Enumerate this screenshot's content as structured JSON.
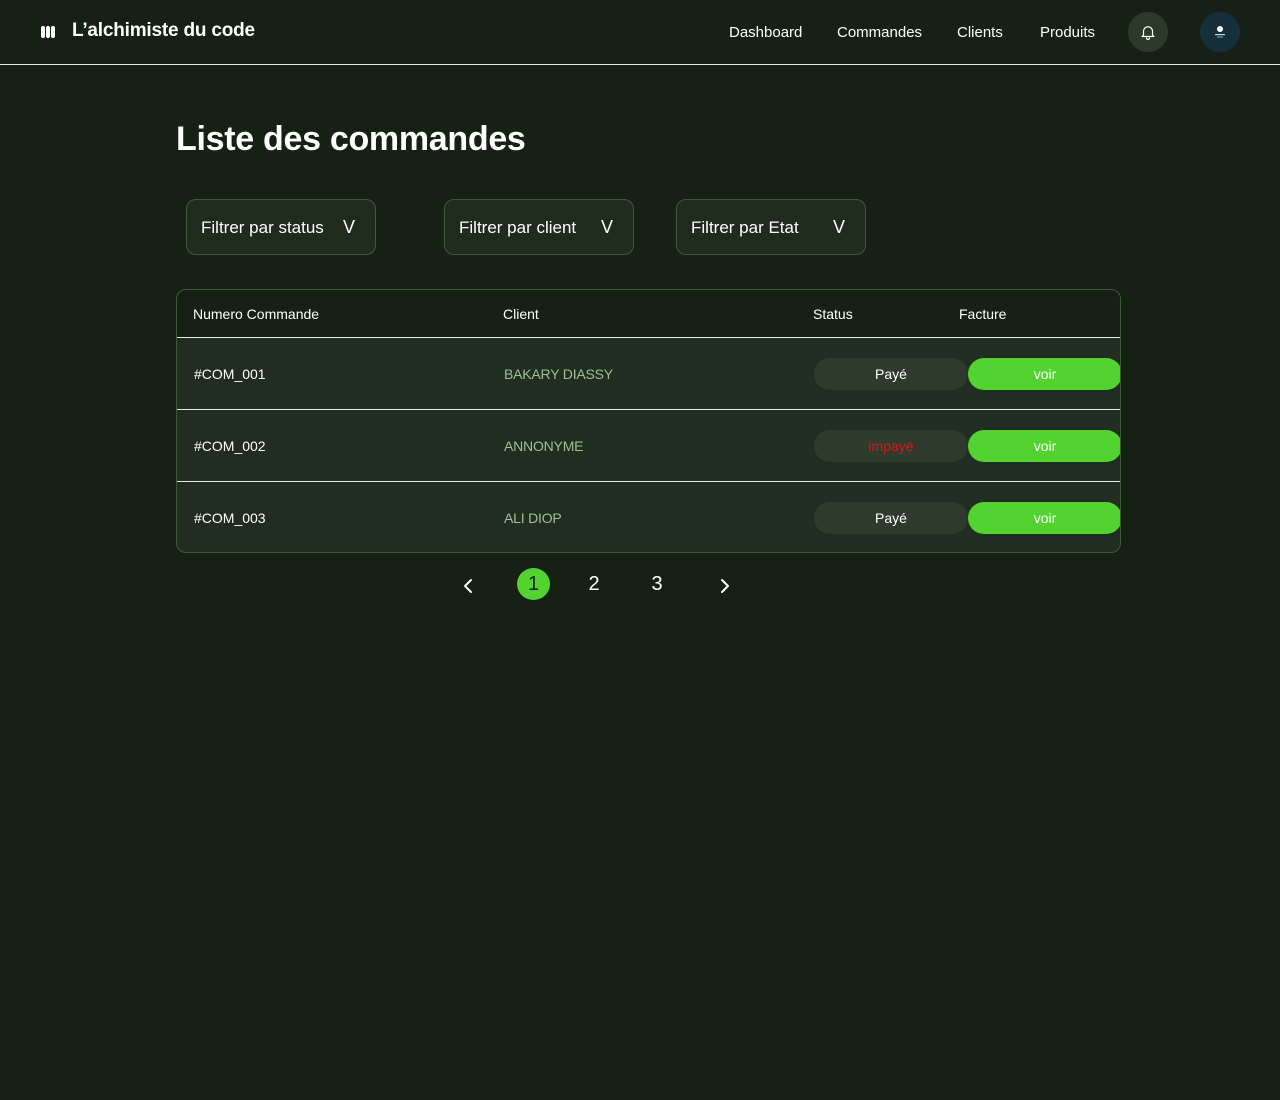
{
  "header": {
    "brand": "L’alchimiste du code",
    "nav": [
      "Dashboard",
      "Commandes",
      "Clients",
      "Produits"
    ]
  },
  "page_title": "Liste des commandes",
  "filters": [
    {
      "label": "Filtrer par status",
      "chevron": "V"
    },
    {
      "label": "Filtrer par client",
      "chevron": "V"
    },
    {
      "label": "Filtrer par Etat",
      "chevron": "V"
    }
  ],
  "table": {
    "columns": [
      "Numero Commande",
      "Client",
      "Status",
      "Facture"
    ],
    "rows": [
      {
        "numero": "#COM_001",
        "client": "BAKARY DIASSY",
        "status": "Payé",
        "facture": "voir"
      },
      {
        "numero": "#COM_002",
        "client": "ANNONYME",
        "status": "impayé",
        "facture": "voir"
      },
      {
        "numero": "#COM_003",
        "client": "ALI DIOP",
        "status": "Payé",
        "facture": "voir"
      }
    ]
  },
  "pagination": {
    "pages": [
      "1",
      "2",
      "3"
    ],
    "current": "1"
  },
  "colors": {
    "background": "#172014",
    "accent": "#52d330",
    "unpaid": "#e0121a",
    "client_text": "#9fbf94"
  },
  "icons": {
    "logo": "logo-icon",
    "notification": "bell-icon",
    "avatar": "avatar-icon",
    "prev": "chevron-left-icon",
    "next": "chevron-right-icon"
  }
}
